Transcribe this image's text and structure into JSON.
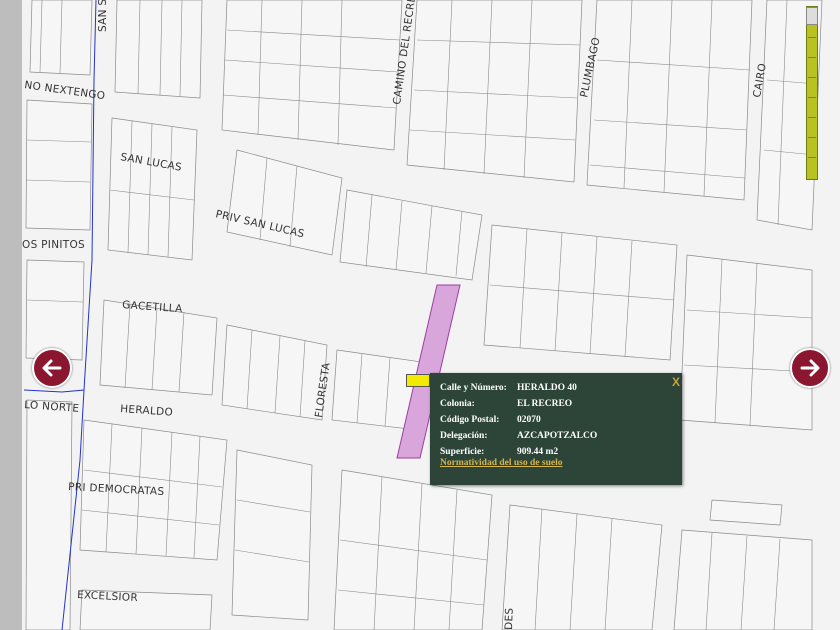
{
  "streets": {
    "san_s": "SAN S",
    "camino_del_recreo": "CAMINO DEL RECREO",
    "plumbago": "PLUMBAGO",
    "cairo": "CAIRO",
    "nextengo": "NO NEXTENGO",
    "san_lucas": "SAN LUCAS",
    "priv_san_lucas": "PRIV SAN LUCAS",
    "los_pinitos": "OS PINITOS",
    "gacetilla": "GACETILLA",
    "floresta": "FLORESTA",
    "heraldo": "HERALDO",
    "lo_norte": "LO NORTE",
    "pri_democratas": "PRI DEMOCRATAS",
    "excelsior": "EXCELSIOR",
    "des": "DES"
  },
  "popup": {
    "close_label": "X",
    "rows": [
      {
        "label": "Calle y Número:",
        "value": "HERALDO 40"
      },
      {
        "label": "Colonia:",
        "value": "EL RECREO"
      },
      {
        "label": "Código Postal:",
        "value": "02070"
      },
      {
        "label": "Delegación:",
        "value": "AZCAPOTZALCO"
      },
      {
        "label": "Superficie:",
        "value": "909.44 m2"
      }
    ],
    "link_text": "Normatividad del uso de suelo"
  },
  "colors": {
    "lot_fill": "#d9a6dc",
    "popup_bg": "#2c4538",
    "arrow_bg": "#8b1630",
    "boundary": "#2233cc",
    "zoom_bar": "#b8c220"
  },
  "icons": {
    "left": "arrow-left-icon",
    "right": "arrow-right-icon",
    "marker": "location-marker-icon"
  }
}
